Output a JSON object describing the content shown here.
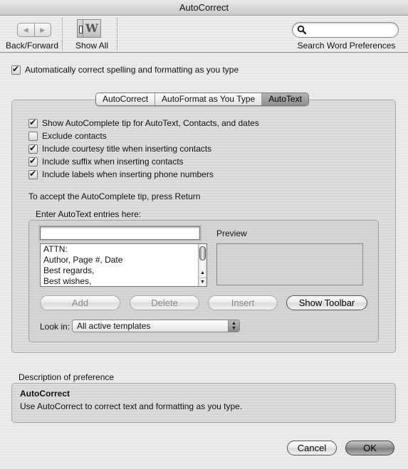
{
  "window": {
    "title": "AutoCorrect"
  },
  "toolbar": {
    "back_forward_label": "Back/Forward",
    "show_all_label": "Show All",
    "show_all_icon_glyph": "W",
    "search_placeholder": "",
    "search_label": "Search Word Preferences"
  },
  "master_checkbox": {
    "label": "Automatically correct spelling and formatting as you type",
    "checked": true
  },
  "tabs": [
    {
      "label": "AutoCorrect",
      "active": false
    },
    {
      "label": "AutoFormat as You Type",
      "active": false
    },
    {
      "label": "AutoText",
      "active": true
    }
  ],
  "options": [
    {
      "label": "Show AutoComplete tip for AutoText, Contacts, and dates",
      "checked": true
    },
    {
      "label": "Exclude contacts",
      "checked": false
    },
    {
      "label": "Include courtesy title when inserting contacts",
      "checked": true
    },
    {
      "label": "Include suffix when inserting contacts",
      "checked": true
    },
    {
      "label": "Include labels when inserting phone numbers",
      "checked": true
    }
  ],
  "accept_tip": "To accept the AutoComplete tip, press Return",
  "entries": {
    "group_label": "Enter AutoText entries here:",
    "input_value": "",
    "list": [
      "ATTN:",
      "Author, Page #, Date",
      "Best regards,",
      "Best wishes,"
    ],
    "preview_label": "Preview",
    "buttons": {
      "add": "Add",
      "delete": "Delete",
      "insert": "Insert",
      "show_toolbar": "Show Toolbar"
    },
    "look_in_label": "Look in:",
    "look_in_value": "All active templates"
  },
  "description": {
    "section_label": "Description of preference",
    "title": "AutoCorrect",
    "text": "Use AutoCorrect to correct text and formatting as you type."
  },
  "footer": {
    "cancel": "Cancel",
    "ok": "OK"
  }
}
